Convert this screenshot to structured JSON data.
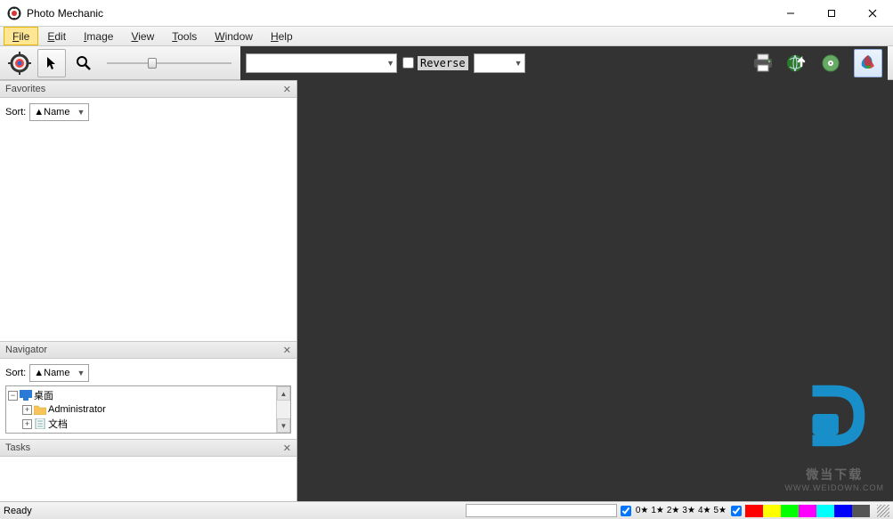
{
  "window": {
    "title": "Photo Mechanic",
    "controls": {
      "min": "—",
      "max": "☐",
      "close": "✕"
    }
  },
  "menu": {
    "items": [
      {
        "label": "File",
        "u": "F",
        "rest": "ile",
        "active": true
      },
      {
        "label": "Edit",
        "u": "E",
        "rest": "dit"
      },
      {
        "label": "Image",
        "u": "I",
        "rest": "mage"
      },
      {
        "label": "View",
        "u": "V",
        "rest": "iew"
      },
      {
        "label": "Tools",
        "u": "T",
        "rest": "ools"
      },
      {
        "label": "Window",
        "u": "W",
        "rest": "indow"
      },
      {
        "label": "Help",
        "u": "H",
        "rest": "elp"
      }
    ]
  },
  "toolbar": {
    "filter_combo": "",
    "reverse_label": "Reverse",
    "sort_combo": ""
  },
  "panels": {
    "favorites": {
      "title": "Favorites",
      "sort_label": "Sort:",
      "sort_value": "▲Name"
    },
    "navigator": {
      "title": "Navigator",
      "sort_label": "Sort:",
      "sort_value": "▲Name",
      "tree": [
        {
          "level": 0,
          "expand": "−",
          "icon": "desktop",
          "label": "桌面"
        },
        {
          "level": 1,
          "expand": "+",
          "icon": "folder",
          "label": "Administrator"
        },
        {
          "level": 1,
          "expand": "+",
          "icon": "doc",
          "label": "文档"
        }
      ]
    },
    "tasks": {
      "title": "Tasks"
    }
  },
  "watermark": {
    "line1": "微当下载",
    "line2": "WWW.WEIDOWN.COM"
  },
  "status": {
    "text": "Ready",
    "rating_labels": [
      "0★",
      "1★",
      "2★",
      "3★",
      "4★",
      "5★"
    ],
    "colors": [
      "#ff0000",
      "#ffff00",
      "#00ff00",
      "#ff00ff",
      "#00ffff",
      "#0000ff",
      "#555555"
    ]
  }
}
